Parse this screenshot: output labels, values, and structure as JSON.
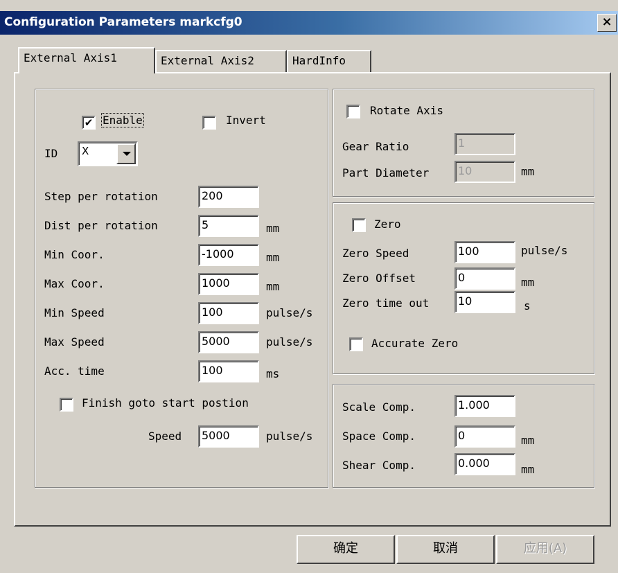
{
  "window": {
    "title": "Configuration Parameters markcfg0",
    "close_label": "×"
  },
  "tabs": [
    "External Axis1",
    "External Axis2",
    "HardInfo"
  ],
  "left": {
    "enable_label": "Enable",
    "enable_checked": true,
    "invert_label": "Invert",
    "invert_checked": false,
    "id_label": "ID",
    "id_value": "X",
    "step_label": "Step per rotation",
    "step_value": "200",
    "dist_label": "Dist per rotation",
    "dist_value": "5",
    "dist_unit": "mm",
    "min_coor_label": "Min Coor.",
    "min_coor_value": "-1000",
    "min_coor_unit": "mm",
    "max_coor_label": "Max Coor.",
    "max_coor_value": "1000",
    "max_coor_unit": "mm",
    "min_speed_label": "Min Speed",
    "min_speed_value": "100",
    "min_speed_unit": "pulse/s",
    "max_speed_label": "Max Speed",
    "max_speed_value": "5000",
    "max_speed_unit": "pulse/s",
    "acc_label": "Acc. time",
    "acc_value": "100",
    "acc_unit": "ms",
    "finish_label": "Finish goto start postion",
    "finish_checked": false,
    "speed_label": "Speed",
    "speed_value": "5000",
    "speed_unit": "pulse/s"
  },
  "rotate": {
    "label": "Rotate Axis",
    "checked": false,
    "gear_label": "Gear Ratio",
    "gear_value": "1",
    "diam_label": "Part Diameter",
    "diam_value": "10",
    "diam_unit": "mm"
  },
  "zero": {
    "label": "Zero",
    "checked": false,
    "speed_label": "Zero Speed",
    "speed_value": "100",
    "speed_unit": "pulse/s",
    "offset_label": "Zero Offset",
    "offset_value": "0",
    "offset_unit": "mm",
    "timeout_label": "Zero time out",
    "timeout_value": "10",
    "timeout_unit": "s",
    "accurate_label": "Accurate Zero",
    "accurate_checked": false
  },
  "comp": {
    "scale_label": "Scale Comp.",
    "scale_value": "1.000",
    "space_label": "Space Comp.",
    "space_value": "0",
    "space_unit": "mm",
    "shear_label": "Shear Comp.",
    "shear_value": "0.000",
    "shear_unit": "mm"
  },
  "buttons": {
    "ok": "确定",
    "cancel": "取消",
    "apply": "应用(A)"
  }
}
